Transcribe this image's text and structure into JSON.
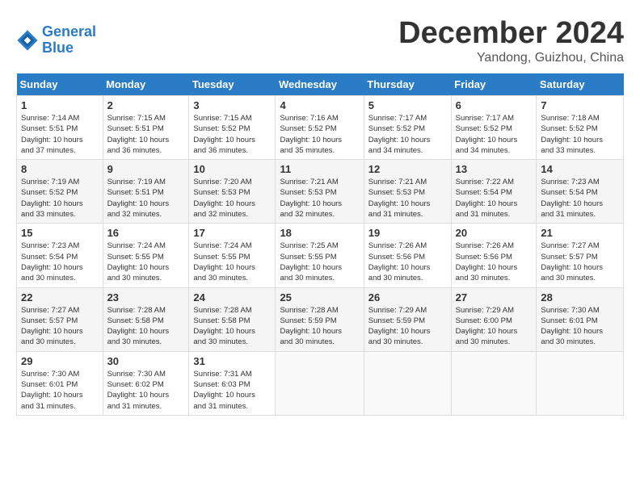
{
  "header": {
    "logo_line1": "General",
    "logo_line2": "Blue",
    "title": "December 2024",
    "subtitle": "Yandong, Guizhou, China"
  },
  "days_of_week": [
    "Sunday",
    "Monday",
    "Tuesday",
    "Wednesday",
    "Thursday",
    "Friday",
    "Saturday"
  ],
  "weeks": [
    [
      {
        "day": "1",
        "info": "Sunrise: 7:14 AM\nSunset: 5:51 PM\nDaylight: 10 hours\nand 37 minutes."
      },
      {
        "day": "2",
        "info": "Sunrise: 7:15 AM\nSunset: 5:51 PM\nDaylight: 10 hours\nand 36 minutes."
      },
      {
        "day": "3",
        "info": "Sunrise: 7:15 AM\nSunset: 5:52 PM\nDaylight: 10 hours\nand 36 minutes."
      },
      {
        "day": "4",
        "info": "Sunrise: 7:16 AM\nSunset: 5:52 PM\nDaylight: 10 hours\nand 35 minutes."
      },
      {
        "day": "5",
        "info": "Sunrise: 7:17 AM\nSunset: 5:52 PM\nDaylight: 10 hours\nand 34 minutes."
      },
      {
        "day": "6",
        "info": "Sunrise: 7:17 AM\nSunset: 5:52 PM\nDaylight: 10 hours\nand 34 minutes."
      },
      {
        "day": "7",
        "info": "Sunrise: 7:18 AM\nSunset: 5:52 PM\nDaylight: 10 hours\nand 33 minutes."
      }
    ],
    [
      {
        "day": "8",
        "info": "Sunrise: 7:19 AM\nSunset: 5:52 PM\nDaylight: 10 hours\nand 33 minutes."
      },
      {
        "day": "9",
        "info": "Sunrise: 7:19 AM\nSunset: 5:51 PM\nDaylight: 10 hours\nand 32 minutes."
      },
      {
        "day": "10",
        "info": "Sunrise: 7:20 AM\nSunset: 5:53 PM\nDaylight: 10 hours\nand 32 minutes."
      },
      {
        "day": "11",
        "info": "Sunrise: 7:21 AM\nSunset: 5:53 PM\nDaylight: 10 hours\nand 32 minutes."
      },
      {
        "day": "12",
        "info": "Sunrise: 7:21 AM\nSunset: 5:53 PM\nDaylight: 10 hours\nand 31 minutes."
      },
      {
        "day": "13",
        "info": "Sunrise: 7:22 AM\nSunset: 5:54 PM\nDaylight: 10 hours\nand 31 minutes."
      },
      {
        "day": "14",
        "info": "Sunrise: 7:23 AM\nSunset: 5:54 PM\nDaylight: 10 hours\nand 31 minutes."
      }
    ],
    [
      {
        "day": "15",
        "info": "Sunrise: 7:23 AM\nSunset: 5:54 PM\nDaylight: 10 hours\nand 30 minutes."
      },
      {
        "day": "16",
        "info": "Sunrise: 7:24 AM\nSunset: 5:55 PM\nDaylight: 10 hours\nand 30 minutes."
      },
      {
        "day": "17",
        "info": "Sunrise: 7:24 AM\nSunset: 5:55 PM\nDaylight: 10 hours\nand 30 minutes."
      },
      {
        "day": "18",
        "info": "Sunrise: 7:25 AM\nSunset: 5:55 PM\nDaylight: 10 hours\nand 30 minutes."
      },
      {
        "day": "19",
        "info": "Sunrise: 7:26 AM\nSunset: 5:56 PM\nDaylight: 10 hours\nand 30 minutes."
      },
      {
        "day": "20",
        "info": "Sunrise: 7:26 AM\nSunset: 5:56 PM\nDaylight: 10 hours\nand 30 minutes."
      },
      {
        "day": "21",
        "info": "Sunrise: 7:27 AM\nSunset: 5:57 PM\nDaylight: 10 hours\nand 30 minutes."
      }
    ],
    [
      {
        "day": "22",
        "info": "Sunrise: 7:27 AM\nSunset: 5:57 PM\nDaylight: 10 hours\nand 30 minutes."
      },
      {
        "day": "23",
        "info": "Sunrise: 7:28 AM\nSunset: 5:58 PM\nDaylight: 10 hours\nand 30 minutes."
      },
      {
        "day": "24",
        "info": "Sunrise: 7:28 AM\nSunset: 5:58 PM\nDaylight: 10 hours\nand 30 minutes."
      },
      {
        "day": "25",
        "info": "Sunrise: 7:28 AM\nSunset: 5:59 PM\nDaylight: 10 hours\nand 30 minutes."
      },
      {
        "day": "26",
        "info": "Sunrise: 7:29 AM\nSunset: 5:59 PM\nDaylight: 10 hours\nand 30 minutes."
      },
      {
        "day": "27",
        "info": "Sunrise: 7:29 AM\nSunset: 6:00 PM\nDaylight: 10 hours\nand 30 minutes."
      },
      {
        "day": "28",
        "info": "Sunrise: 7:30 AM\nSunset: 6:01 PM\nDaylight: 10 hours\nand 30 minutes."
      }
    ],
    [
      {
        "day": "29",
        "info": "Sunrise: 7:30 AM\nSunset: 6:01 PM\nDaylight: 10 hours\nand 31 minutes."
      },
      {
        "day": "30",
        "info": "Sunrise: 7:30 AM\nSunset: 6:02 PM\nDaylight: 10 hours\nand 31 minutes."
      },
      {
        "day": "31",
        "info": "Sunrise: 7:31 AM\nSunset: 6:03 PM\nDaylight: 10 hours\nand 31 minutes."
      },
      {
        "day": "",
        "info": ""
      },
      {
        "day": "",
        "info": ""
      },
      {
        "day": "",
        "info": ""
      },
      {
        "day": "",
        "info": ""
      }
    ]
  ]
}
